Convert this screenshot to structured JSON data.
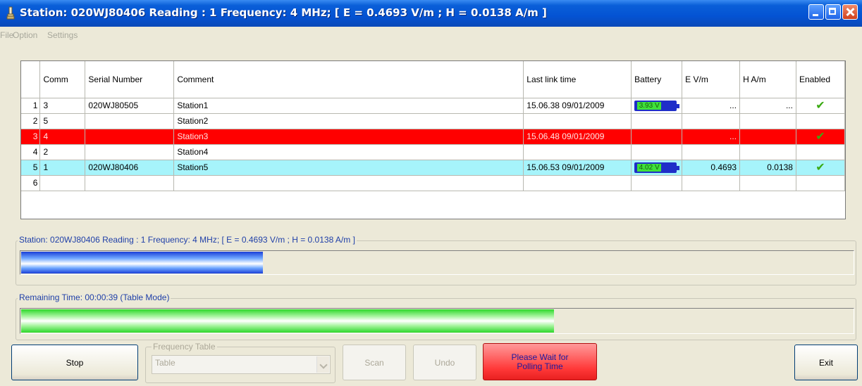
{
  "window": {
    "title": "Station: 020WJ80406 Reading : 1 Frequency: 4 MHz; [ E = 0.4693  V/m ; H = 0.0138  A/m ]"
  },
  "menu": [
    "File",
    "Option",
    "Settings"
  ],
  "table": {
    "headers": [
      "",
      "Comm",
      "Serial Number",
      "Comment",
      "Last link time",
      "Battery",
      "E V/m",
      "H A/m",
      "Enabled"
    ],
    "rows": [
      {
        "num": "1",
        "comm": "3",
        "serial": "020WJ80505",
        "comment": "Station1",
        "last_link": "15.06.38 09/01/2009",
        "battery": "3.93 V",
        "e": "...",
        "h": "...",
        "enabled": "✔"
      },
      {
        "num": "2",
        "comm": "5",
        "serial": "",
        "comment": "Station2",
        "last_link": "",
        "battery": "",
        "e": "",
        "h": "",
        "enabled": ""
      },
      {
        "num": "3",
        "comm": "4",
        "serial": "",
        "comment": "Station3",
        "last_link": "15.06.48 09/01/2009",
        "battery": "",
        "e": "...",
        "h": "",
        "enabled": "✔"
      },
      {
        "num": "4",
        "comm": "2",
        "serial": "",
        "comment": "Station4",
        "last_link": "",
        "battery": "",
        "e": "",
        "h": "",
        "enabled": ""
      },
      {
        "num": "5",
        "comm": "1",
        "serial": "020WJ80406",
        "comment": "Station5",
        "last_link": "15.06.53 09/01/2009",
        "battery": "4.02 V",
        "e": "0.4693",
        "h": "0.0138",
        "enabled": "✔"
      },
      {
        "num": "6",
        "comm": "",
        "serial": "",
        "comment": "",
        "last_link": "",
        "battery": "",
        "e": "",
        "h": "",
        "enabled": ""
      }
    ]
  },
  "reading_progress": {
    "label": "Station: 020WJ80406 Reading : 1 Frequency: 4 MHz; [ E = 0.4693  V/m ; H = 0.0138  A/m ]",
    "fraction": 0.29
  },
  "remaining_progress": {
    "label": "Remaining Time: 00:00:39 (Table Mode)",
    "fraction": 0.64
  },
  "controls": {
    "stop_label": "Stop",
    "frequency_table_label": "Frequency Table",
    "frequency_table_value": "Table",
    "scan_label": "Scan",
    "undo_label": "Undo",
    "wait_line1": "Please Wait for",
    "wait_line2": "Polling Time",
    "exit_label": "Exit"
  },
  "colors": {
    "title_bar": "#0453d3",
    "row_red": "#ff0000",
    "row_cyan": "#a6f4fb",
    "battery_fill": "#3fe23a",
    "progress_blue": "#1a3fd8",
    "progress_green": "#2dd82a"
  }
}
